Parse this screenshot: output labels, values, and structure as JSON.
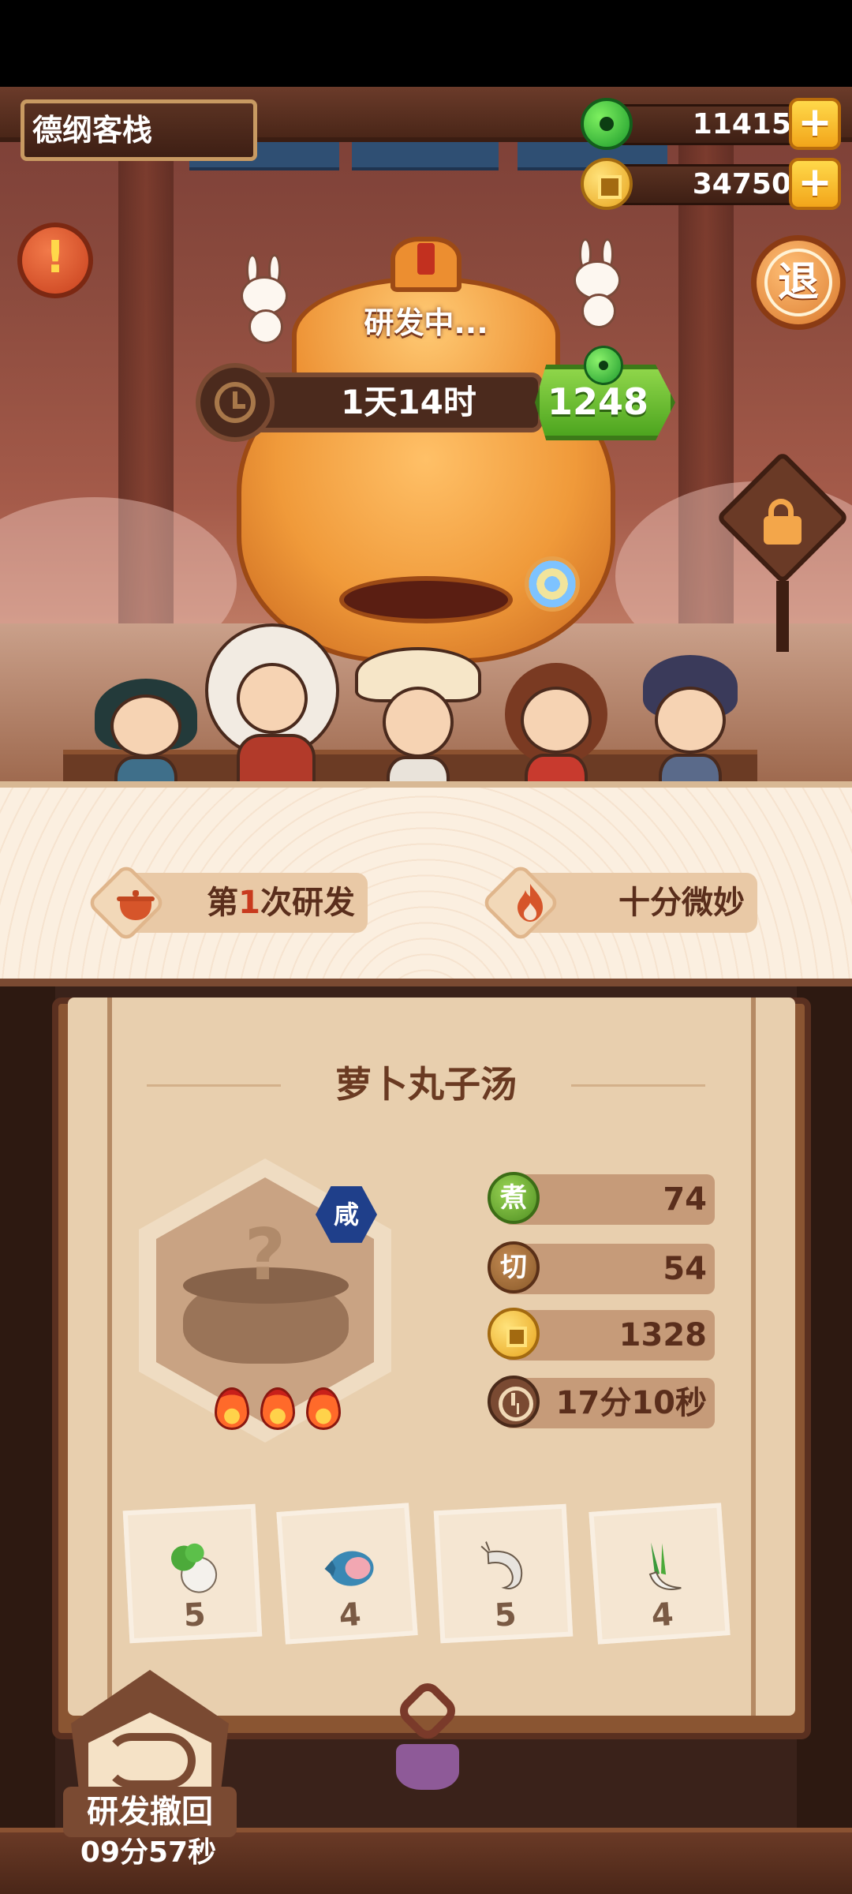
{
  "inn_name": "德纲客栈",
  "currencies": {
    "jade": {
      "icon": "jade-icon",
      "value": "11415",
      "plus": "+"
    },
    "coins": {
      "icon": "coin-icon",
      "value": "34750",
      "plus": "+"
    }
  },
  "left_alert": "!",
  "exit_label": "退",
  "research": {
    "status": "研发中...",
    "time_remaining": "1天14时",
    "speedup_cost": "1248"
  },
  "info": {
    "attempt_prefix": "第",
    "attempt_number": "1",
    "attempt_suffix": "次研发",
    "hint": "十分微妙"
  },
  "recipe": {
    "name": "萝卜丸子汤",
    "unknown_mark": "?",
    "taste_badge": "咸",
    "difficulty_flames": 3,
    "stats": [
      {
        "icon": "boil-icon",
        "label": "煮",
        "value": "74"
      },
      {
        "icon": "cut-icon",
        "label": "切",
        "value": "54"
      },
      {
        "icon": "coin-icon",
        "label": "",
        "value": "1328"
      },
      {
        "icon": "clock-icon",
        "label": "",
        "value": "17分10秒"
      }
    ],
    "ingredients": [
      {
        "icon": "radish-icon",
        "count": "5"
      },
      {
        "icon": "meat-icon",
        "count": "4"
      },
      {
        "icon": "shrimp-icon",
        "count": "5"
      },
      {
        "icon": "scallion-icon",
        "count": "4"
      }
    ]
  },
  "recall": {
    "label": "研发撤回",
    "time": "09分57秒"
  },
  "colors": {
    "accent_orange": "#f09a3a",
    "speedup_green": "#4da51f",
    "wood_dark": "#3e1f14",
    "panel_paper": "#e8cfae",
    "highlight_red": "#c83a1e"
  }
}
